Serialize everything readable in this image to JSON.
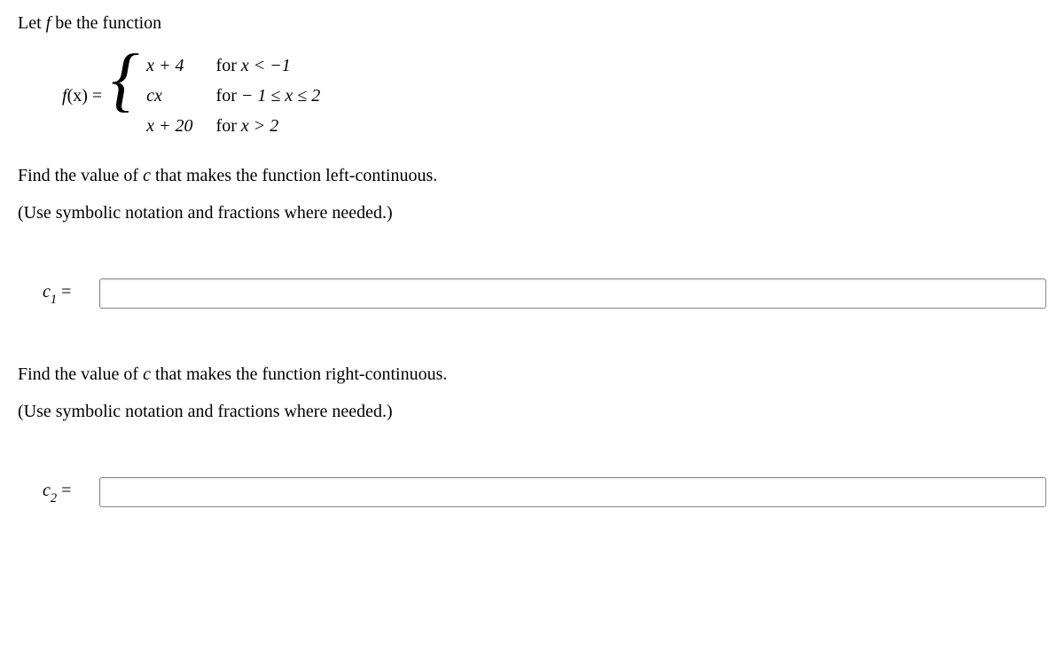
{
  "intro_prefix": "Let ",
  "intro_var": "f",
  "intro_suffix": " be the function",
  "equation": {
    "lhs_var": "f",
    "lhs_arg": "(x)",
    "equals": " = ",
    "cases": [
      {
        "expr": "x + 4",
        "cond_prefix": "for ",
        "cond_math": "x < −1"
      },
      {
        "expr": "cx",
        "cond_prefix": "for ",
        "cond_math": "− 1 ≤ x ≤ 2"
      },
      {
        "expr": "x + 20",
        "cond_prefix": "for ",
        "cond_math": "x > 2"
      }
    ]
  },
  "q1": {
    "prompt_prefix": "Find the value of ",
    "prompt_var": "c",
    "prompt_suffix": " that makes the function left-continuous.",
    "hint": "(Use symbolic notation and fractions where needed.)",
    "label_var": "c",
    "label_sub": "1",
    "label_eq": " =",
    "value": ""
  },
  "q2": {
    "prompt_prefix": "Find the value of ",
    "prompt_var": "c",
    "prompt_suffix": " that makes the function right-continuous.",
    "hint": "(Use symbolic notation and fractions where needed.)",
    "label_var": "c",
    "label_sub": "2",
    "label_eq": " =",
    "value": ""
  }
}
